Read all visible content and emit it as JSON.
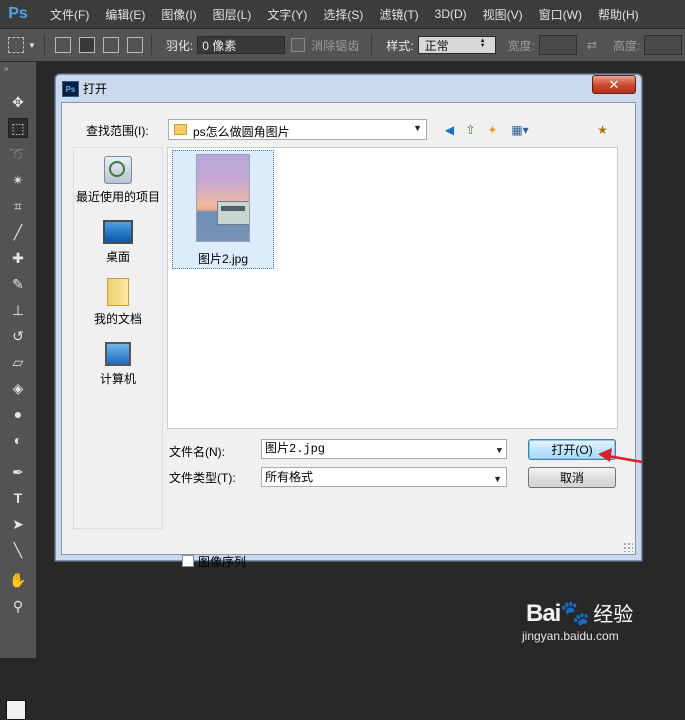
{
  "app": {
    "logo": "Ps"
  },
  "menu": [
    "文件(F)",
    "编辑(E)",
    "图像(I)",
    "图层(L)",
    "文字(Y)",
    "选择(S)",
    "滤镜(T)",
    "3D(D)",
    "视图(V)",
    "窗口(W)",
    "帮助(H)"
  ],
  "options": {
    "feather_label": "羽化:",
    "feather_value": "0 像素",
    "antialias_label": "消除锯齿",
    "style_label": "样式:",
    "style_value": "正常",
    "width_label": "宽度:",
    "height_label": "高度:"
  },
  "dialog": {
    "title": "打开",
    "icon_text": "Ps",
    "close_symbol": "✕",
    "lookin_label": "查找范围(I):",
    "lookin_value": "ps怎么做圆角图片",
    "places": [
      {
        "label": "最近使用的项目",
        "icon": "recent-items-icon"
      },
      {
        "label": "桌面",
        "icon": "desktop-icon"
      },
      {
        "label": "我的文档",
        "icon": "my-documents-icon"
      },
      {
        "label": "计算机",
        "icon": "computer-icon"
      }
    ],
    "files": [
      {
        "name": "图片2.jpg"
      }
    ],
    "filename_label": "文件名(N):",
    "filename_value": "图片2.jpg",
    "filetype_label": "文件类型(T):",
    "filetype_value": "所有格式",
    "open_button": "打开(O)",
    "cancel_button": "取消",
    "image_sequence_label": "图像序列"
  },
  "watermark": {
    "logo_left": "Bai",
    "logo_right": "经验",
    "url": "jingyan.baidu.com"
  },
  "colors": {
    "accent_red": "#d8202a",
    "dialog_frame": "#cad9ec",
    "ps_background": "#282828"
  }
}
